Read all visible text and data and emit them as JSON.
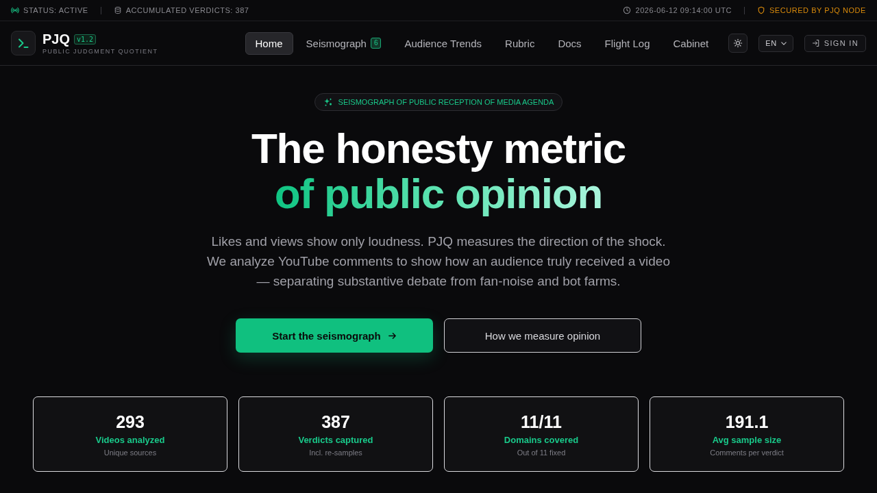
{
  "top_bar": {
    "status": "STATUS: ACTIVE",
    "verdicts": "ACCUMULATED VERDICTS: 387",
    "timestamp": "2026-06-12 09:14:00 UTC",
    "security": "SECURED BY PJQ NODE"
  },
  "header": {
    "logo": {
      "name": "PJQ",
      "version": "v1.2",
      "tagline": "PUBLIC JUDGMENT QUOTIENT"
    },
    "nav": [
      {
        "label": "Home",
        "selected": true
      },
      {
        "label": "Seismograph",
        "badge": "6",
        "selected": false
      },
      {
        "label": "Audience Trends",
        "selected": false
      },
      {
        "label": "Rubric",
        "selected": false
      },
      {
        "label": "Docs",
        "selected": false
      },
      {
        "label": "Flight Log",
        "selected": false
      },
      {
        "label": "Cabinet",
        "selected": false
      }
    ],
    "language": "EN",
    "sign_in": "SIGN IN"
  },
  "hero": {
    "tag": "SEISMOGRAPH OF PUBLIC RECEPTION OF MEDIA AGENDA",
    "title": "The honesty metric",
    "title_accent": "of public opinion",
    "lead": "Likes and views show only loudness. PJQ measures the direction of the shock. We analyze YouTube comments to show how an audience truly received a video — separating substantive debate from fan-noise and bot farms.",
    "buttons": [
      {
        "label": "Start the seismograph",
        "kind": "primary"
      },
      {
        "label": "How we measure opinion",
        "kind": "secondary"
      }
    ]
  },
  "stats": [
    {
      "value": "293",
      "label": "Videos analyzed",
      "note": "Unique sources"
    },
    {
      "value": "387",
      "label": "Verdicts captured",
      "note": "Incl. re-samples"
    },
    {
      "value": "11/11",
      "label": "Domains covered",
      "note": "Out of 11 fixed"
    },
    {
      "value": "191.1",
      "label": "Avg sample size",
      "note": "Comments per verdict"
    }
  ]
}
